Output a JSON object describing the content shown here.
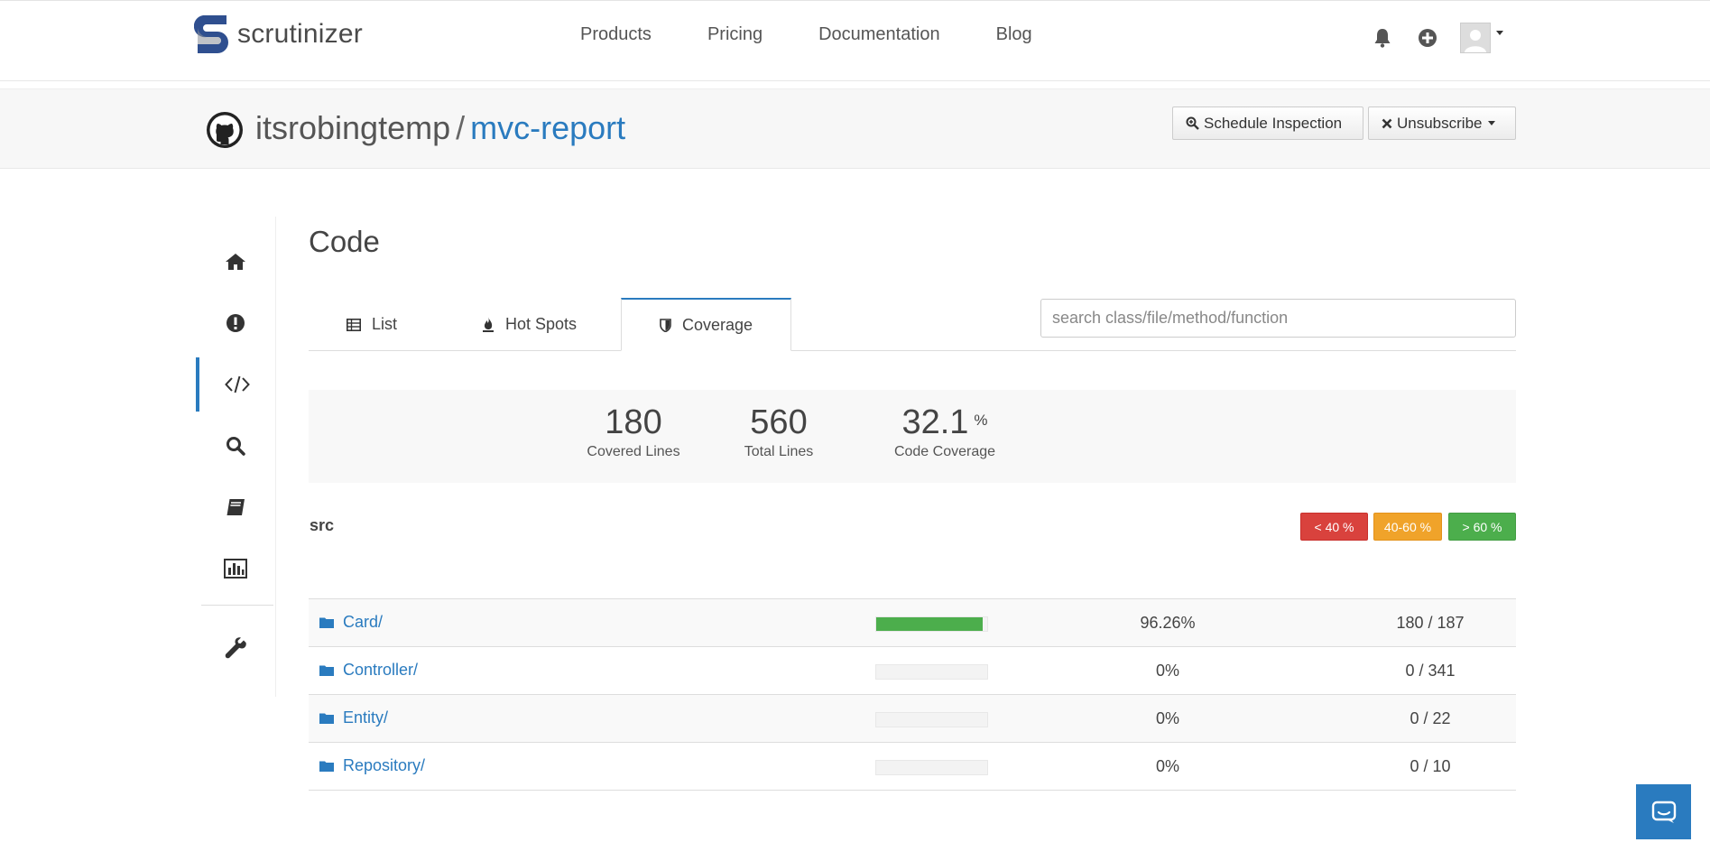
{
  "brand": {
    "name": "scrutinizer"
  },
  "nav": {
    "links": [
      "Products",
      "Pricing",
      "Documentation",
      "Blog"
    ]
  },
  "repo": {
    "owner": "itsrobingtemp",
    "separator": "/",
    "name": "mvc-report"
  },
  "actions": {
    "schedule_label": "Schedule Inspection",
    "unsubscribe_label": "Unsubscribe"
  },
  "page": {
    "title": "Code"
  },
  "tabs": [
    {
      "label": "List",
      "icon": "table-icon"
    },
    {
      "label": "Hot Spots",
      "icon": "fire-icon"
    },
    {
      "label": "Coverage",
      "icon": "shield-icon",
      "active": true
    }
  ],
  "search": {
    "placeholder": "search class/file/method/function",
    "value": ""
  },
  "stats": [
    {
      "value": "180",
      "label": "Covered Lines"
    },
    {
      "value": "560",
      "label": "Total Lines"
    },
    {
      "value": "32.1",
      "unit": "%",
      "label": "Code Coverage"
    }
  ],
  "section": {
    "name": "src"
  },
  "legend": [
    {
      "label": "< 40 %",
      "color": "#d9423d"
    },
    {
      "label": "40-60 %",
      "color": "#f0a32a"
    },
    {
      "label": "> 60 %",
      "color": "#4cae4c"
    }
  ],
  "rows": [
    {
      "name": "Card/",
      "coverage_fraction": 0.9626,
      "pct": "96.26%",
      "lines": "180 / 187"
    },
    {
      "name": "Controller/",
      "coverage_fraction": 0,
      "pct": "0%",
      "lines": "0 / 341"
    },
    {
      "name": "Entity/",
      "coverage_fraction": 0,
      "pct": "0%",
      "lines": "0 / 22"
    },
    {
      "name": "Repository/",
      "coverage_fraction": 0,
      "pct": "0%",
      "lines": "0 / 10"
    }
  ],
  "colors": {
    "accent": "#2a7bbf",
    "good": "#4cae4c"
  }
}
